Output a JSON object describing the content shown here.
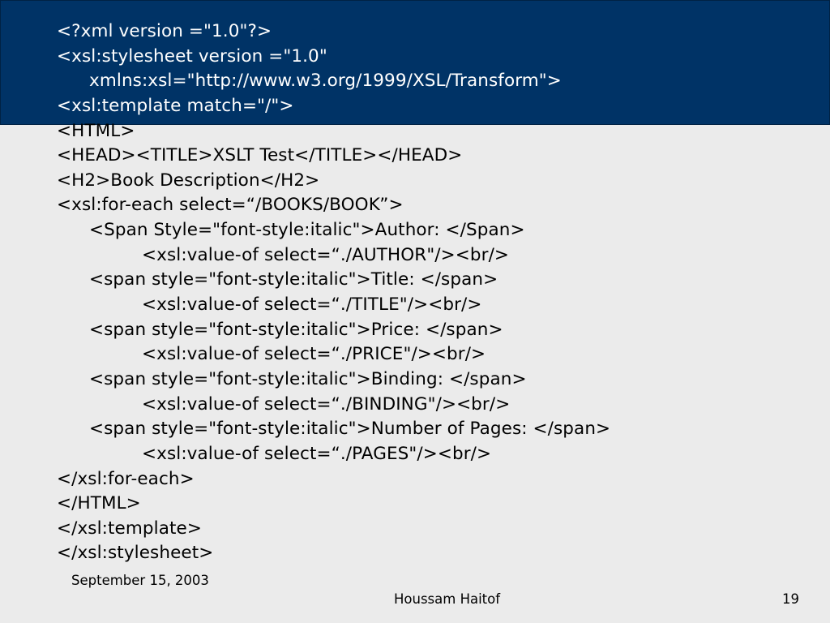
{
  "slide": {
    "background_color": "#ebebeb",
    "band_color": "#003366",
    "code_lines": [
      "<?xml version =\"1.0\"?>",
      "<xsl:stylesheet version =\"1.0\"",
      "xmlns:xsl=\"http://www.w3.org/1999/XSL/Transform\">",
      "<xsl:template match=\"/\">",
      "<HTML>",
      "<HEAD><TITLE>XSLT Test</TITLE></HEAD>",
      "<H2>Book Description</H2>",
      "<xsl:for-each select=“/BOOKS/BOOK”>",
      "<Span Style=\"font-style:italic\">Author: </Span>",
      "<xsl:value-of select=“./AUTHOR\"/><br/>",
      "<span style=\"font-style:italic\">Title: </span>",
      "<xsl:value-of select=“./TITLE\"/><br/>",
      "<span style=\"font-style:italic\">Price: </span>",
      "<xsl:value-of select=“./PRICE\"/><br/>",
      "<span style=\"font-style:italic\">Binding: </span>",
      "<xsl:value-of select=“./BINDING\"/><br/>",
      "<span style=\"font-style:italic\">Number of Pages: </span>",
      "<xsl:value-of select=“./PAGES\"/><br/>",
      "</xsl:for-each>",
      "</HTML>",
      "</xsl:template>",
      "</xsl:stylesheet>"
    ]
  },
  "footer": {
    "date": "September 15, 2003",
    "author": "Houssam Haitof",
    "page_number": "19"
  }
}
